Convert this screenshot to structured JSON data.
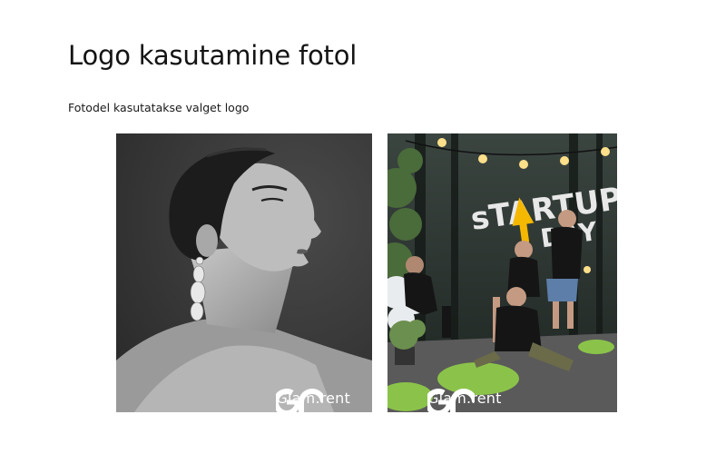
{
  "page": {
    "title": "Logo kasutamine fotol",
    "subtitle": "Fotodel kasutatakse valget logo"
  },
  "photos": [
    {
      "logo_text": "Glam.rent",
      "logo_icon": "glam-rent-logo-mark"
    },
    {
      "logo_text": "Glam.rent",
      "logo_icon": "glam-rent-logo-mark",
      "backdrop_text": "sTARTUP DAY"
    }
  ],
  "colors": {
    "logo": "#ffffff",
    "startup_accent": "#f5b800",
    "moss": "#8bc34a"
  }
}
